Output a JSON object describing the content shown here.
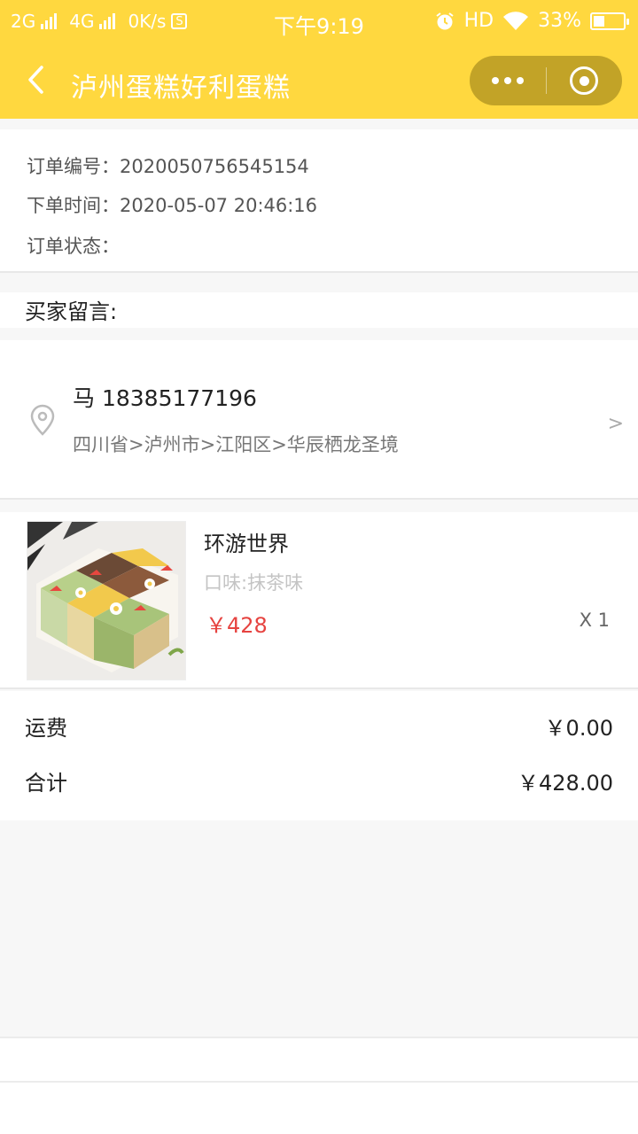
{
  "status_bar": {
    "net1": "2G",
    "net2": "4G",
    "speed": "0K/s",
    "time": "下午9:19",
    "hd": "HD",
    "battery": "33%"
  },
  "nav": {
    "title": "泸州蛋糕好利蛋糕"
  },
  "order": {
    "number_label": "订单编号：",
    "number_value": "2020050756545154",
    "time_label": "下单时间：",
    "time_value": "2020-05-07 20:46:16",
    "status_label": "订单状态：",
    "status_value": ""
  },
  "message": {
    "label": "买家留言:"
  },
  "address": {
    "recipient": "马 18385177196",
    "line": "四川省>泸州市>江阳区>华辰栖龙圣境",
    "arrow": ">"
  },
  "product": {
    "name": "环游世界",
    "flavor": "口味:抹茶味",
    "price": "￥428",
    "qty": "X 1"
  },
  "totals": {
    "shipping_label": "运费",
    "shipping_value": "￥0.00",
    "total_label": "合计",
    "total_value": "￥428.00"
  },
  "colors": {
    "header": "#ffd83f",
    "price": "#e64340"
  }
}
